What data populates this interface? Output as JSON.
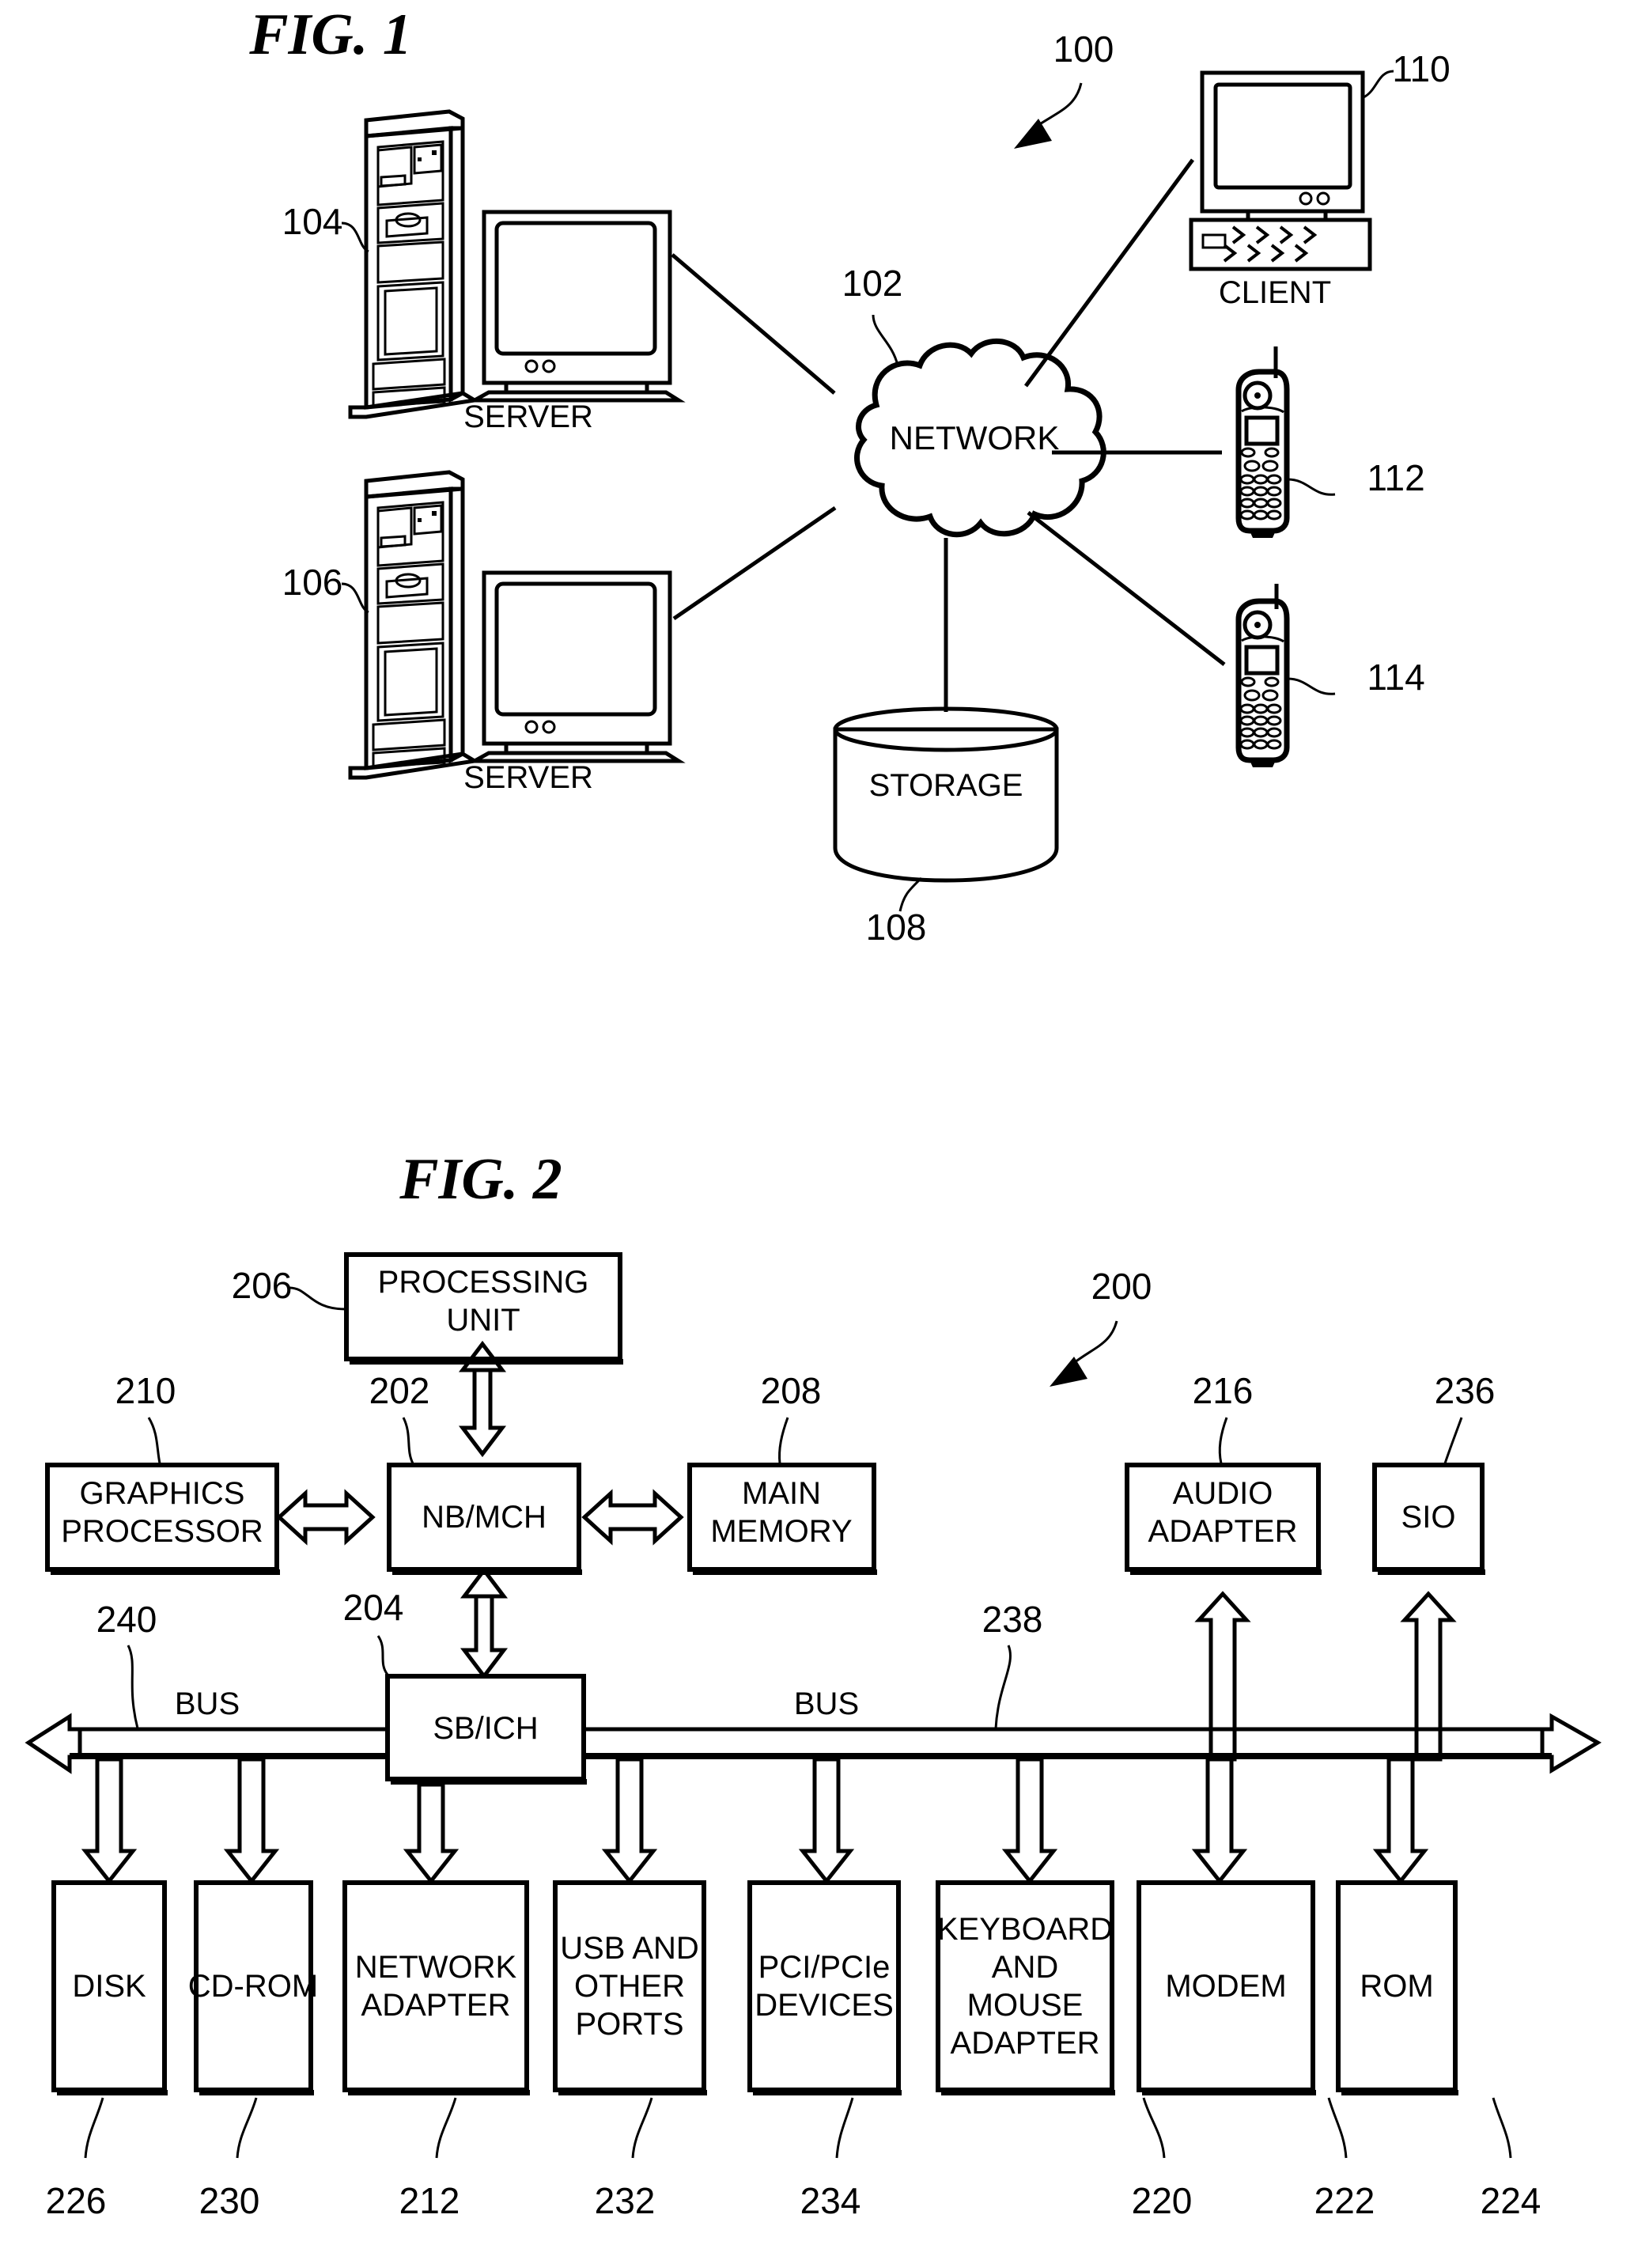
{
  "figures": [
    {
      "id": "fig1",
      "title": "FIG. 1",
      "overall_ref": "100",
      "nodes": {
        "server_top": {
          "label": "SERVER",
          "ref": "104"
        },
        "server_bottom": {
          "label": "SERVER",
          "ref": "106"
        },
        "network": {
          "label": "NETWORK",
          "ref": "102"
        },
        "client": {
          "label": "CLIENT",
          "ref": "110"
        },
        "phone_upper": {
          "label": "",
          "ref": "112"
        },
        "phone_lower": {
          "label": "",
          "ref": "114"
        },
        "storage": {
          "label": "STORAGE",
          "ref": "108"
        }
      }
    },
    {
      "id": "fig2",
      "title": "FIG. 2",
      "overall_ref": "200",
      "blocks": [
        {
          "key": "processing_unit",
          "label": "PROCESSING UNIT",
          "lines": [
            "PROCESSING",
            "UNIT"
          ],
          "ref": "206"
        },
        {
          "key": "graphics_processor",
          "label": "GRAPHICS PROCESSOR",
          "lines": [
            "GRAPHICS",
            "PROCESSOR"
          ],
          "ref": "210"
        },
        {
          "key": "nb_mch",
          "label": "NB/MCH",
          "lines": [
            "NB/MCH"
          ],
          "ref": "202"
        },
        {
          "key": "main_memory",
          "label": "MAIN MEMORY",
          "lines": [
            "MAIN",
            "MEMORY"
          ],
          "ref": "208"
        },
        {
          "key": "audio_adapter",
          "label": "AUDIO ADAPTER",
          "lines": [
            "AUDIO",
            "ADAPTER"
          ],
          "ref": "216"
        },
        {
          "key": "sio",
          "label": "SIO",
          "lines": [
            "SIO"
          ],
          "ref": "236"
        },
        {
          "key": "sb_ich",
          "label": "SB/ICH",
          "lines": [
            "SB/ICH"
          ],
          "ref": "204"
        },
        {
          "key": "disk",
          "label": "DISK",
          "lines": [
            "DISK"
          ],
          "ref": "226"
        },
        {
          "key": "cd_rom",
          "label": "CD-ROM",
          "lines": [
            "CD-ROM"
          ],
          "ref": "230"
        },
        {
          "key": "network_adapter",
          "label": "NETWORK ADAPTER",
          "lines": [
            "NETWORK",
            "ADAPTER"
          ],
          "ref": "212"
        },
        {
          "key": "usb_and_other_ports",
          "label": "USB AND OTHER PORTS",
          "lines": [
            "USB AND",
            "OTHER",
            "PORTS"
          ],
          "ref": "232"
        },
        {
          "key": "pci_pcie_devices",
          "label": "PCI/PCIe DEVICES",
          "lines": [
            "PCI/PCIe",
            "DEVICES"
          ],
          "ref": "234"
        },
        {
          "key": "keyboard_and_mouse_adapter",
          "label": "KEYBOARD AND MOUSE ADAPTER",
          "lines": [
            "KEYBOARD",
            "AND",
            "MOUSE",
            "ADAPTER"
          ],
          "ref": "220"
        },
        {
          "key": "modem",
          "label": "MODEM",
          "lines": [
            "MODEM"
          ],
          "ref": "222"
        },
        {
          "key": "rom",
          "label": "ROM",
          "lines": [
            "ROM"
          ],
          "ref": "224"
        }
      ],
      "buses": [
        {
          "key": "bus_left",
          "label": "BUS",
          "ref": "240"
        },
        {
          "key": "bus_right",
          "label": "BUS",
          "ref": "238"
        }
      ]
    }
  ]
}
